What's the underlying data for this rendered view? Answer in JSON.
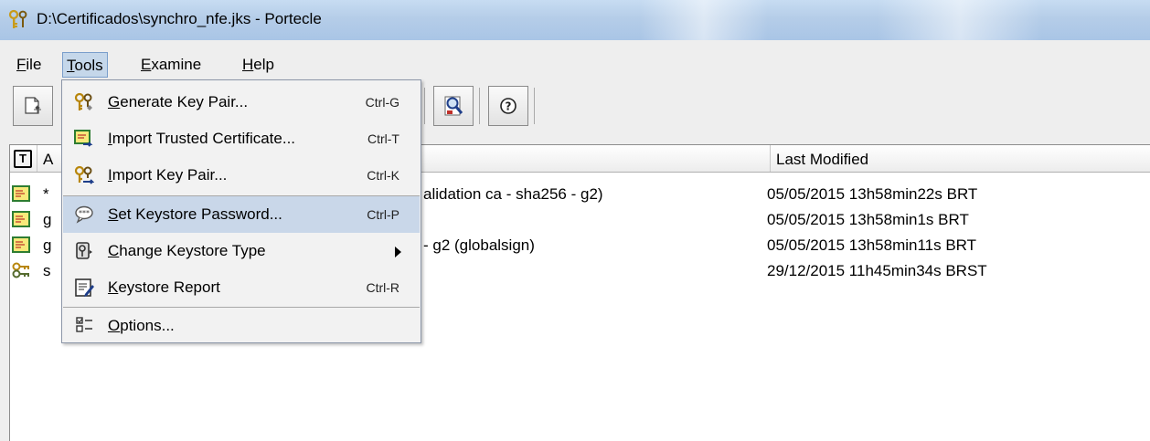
{
  "window": {
    "title": "D:\\Certificados\\synchro_nfe.jks - Portecle"
  },
  "menubar": {
    "items": [
      {
        "pre": "",
        "mn": "F",
        "post": "ile"
      },
      {
        "pre": "",
        "mn": "T",
        "post": "ools"
      },
      {
        "pre": "",
        "mn": "E",
        "post": "xamine"
      },
      {
        "pre": "",
        "mn": "H",
        "post": "elp"
      }
    ]
  },
  "toolbar": {
    "buttons": [
      {
        "icon": "new-keystore-icon"
      },
      {
        "icon": "examine-certificate-icon"
      },
      {
        "icon": "help-icon"
      }
    ]
  },
  "table": {
    "header_type_glyph": "T",
    "header_alias": "A",
    "header_last_modified": "Last Modified",
    "rows": [
      {
        "type_icon": "trusted-certificate-icon",
        "alias_start": "*",
        "alias_visible_end": "alidation ca - sha256 - g2)",
        "last_modified": "05/05/2015 13h58min22s BRT"
      },
      {
        "type_icon": "trusted-certificate-icon",
        "alias_start": "g",
        "alias_visible_end": "",
        "last_modified": "05/05/2015 13h58min1s BRT"
      },
      {
        "type_icon": "trusted-certificate-icon",
        "alias_start": "g",
        "alias_visible_end": "- g2 (globalsign)",
        "last_modified": "05/05/2015 13h58min11s BRT"
      },
      {
        "type_icon": "key-pair-icon",
        "alias_start": "s",
        "alias_visible_end": "",
        "last_modified": "29/12/2015 11h45min34s BRST"
      }
    ]
  },
  "tools_menu": {
    "items": [
      {
        "pre": "",
        "mn": "G",
        "post": "enerate Key Pair...",
        "shortcut": "Ctrl-G",
        "icon": "generate-key-pair-icon"
      },
      {
        "pre": "",
        "mn": "I",
        "post": "mport Trusted Certificate...",
        "shortcut": "Ctrl-T",
        "icon": "import-trusted-certificate-icon"
      },
      {
        "pre": "",
        "mn": "I",
        "post": "mport Key Pair...",
        "shortcut": "Ctrl-K",
        "icon": "import-key-pair-icon"
      },
      {
        "pre": "",
        "mn": "S",
        "post": "et Keystore Password...",
        "shortcut": "Ctrl-P",
        "icon": "set-keystore-password-icon"
      },
      {
        "pre": "",
        "mn": "C",
        "post": "hange Keystore Type",
        "shortcut": "",
        "icon": "change-keystore-type-icon"
      },
      {
        "pre": "",
        "mn": "K",
        "post": "eystore Report",
        "shortcut": "Ctrl-R",
        "icon": "keystore-report-icon"
      },
      {
        "pre": "",
        "mn": "O",
        "post": "ptions...",
        "shortcut": "",
        "icon": "options-icon"
      }
    ]
  },
  "colors": {
    "menu_highlight": "#c9d7e9",
    "titlebar": "#b5cde8"
  }
}
